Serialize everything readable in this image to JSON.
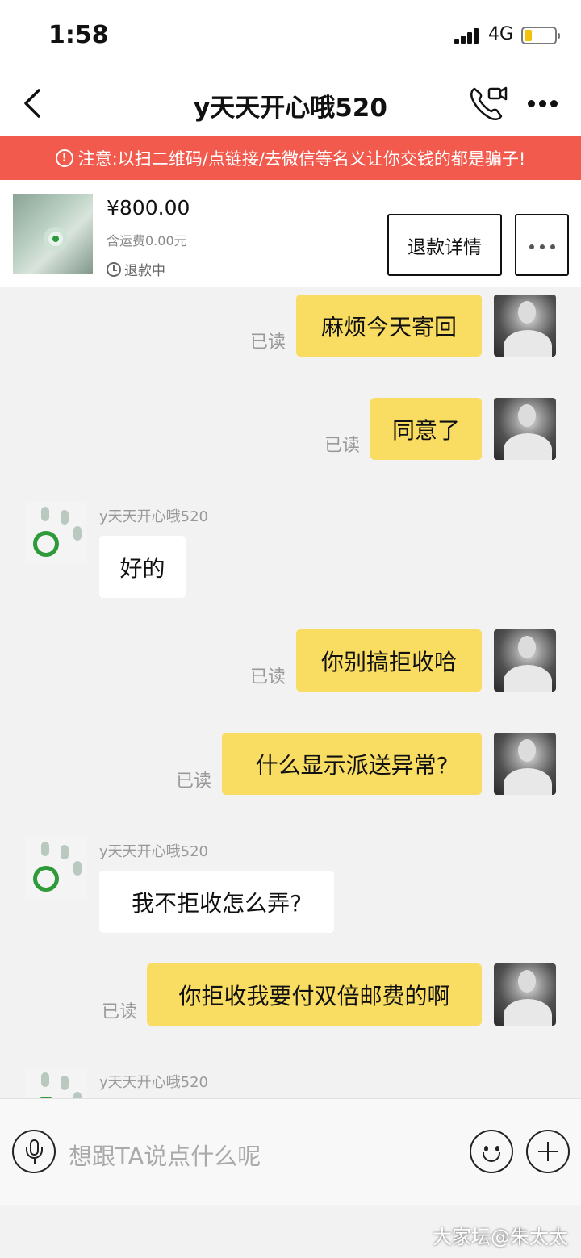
{
  "status_bar": {
    "time": "1:58",
    "network": "4G",
    "battery_level": 0.2,
    "battery_color": "#f2c20c"
  },
  "nav": {
    "title": "y天天开心哦520",
    "back_icon": "chevron-left-icon",
    "call_icon": "phone-video-icon",
    "more_icon": "more-dots-icon"
  },
  "warning": {
    "text": "注意:以扫二维码/点链接/去微信等名义让你交钱的都是骗子!",
    "icon": "!",
    "background": "#f25a4e"
  },
  "product": {
    "price": "¥800.00",
    "shipping": "含运费0.00元",
    "status": "退款中",
    "refund_button": "退款详情"
  },
  "messages": [
    {
      "side": "me",
      "text": "麻烦今天寄回",
      "read": "已读"
    },
    {
      "side": "me",
      "text": "同意了",
      "read": "已读"
    },
    {
      "side": "other",
      "sender": "y天天开心哦520",
      "text": "好的"
    },
    {
      "side": "me",
      "text": "你别搞拒收哈",
      "read": "已读"
    },
    {
      "side": "me",
      "text": "什么显示派送异常?",
      "read": "已读"
    },
    {
      "side": "other",
      "sender": "y天天开心哦520",
      "text": "我不拒收怎么弄?"
    },
    {
      "side": "me",
      "text": "你拒收我要付双倍邮费的啊",
      "read": "已读"
    },
    {
      "side": "other",
      "sender": "y天天开心哦520",
      "text": ""
    }
  ],
  "input": {
    "placeholder": "想跟TA说点什么呢"
  },
  "watermark": "大家坛@朱太太",
  "colors": {
    "my_bubble": "#f9dd62",
    "other_bubble": "#ffffff",
    "chat_background": "#f2f2f2"
  }
}
